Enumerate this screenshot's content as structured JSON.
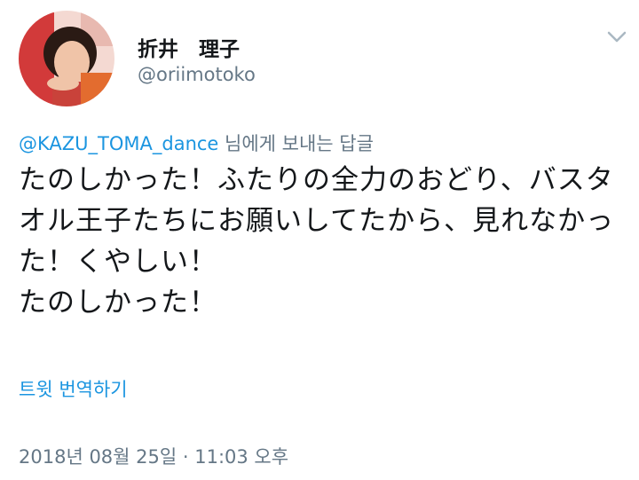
{
  "user": {
    "display_name": "折井　理子",
    "handle": "@oriimotoko"
  },
  "reply": {
    "mention": "@KAZU_TOMA_dance",
    "suffix": " 님에게 보내는 답글"
  },
  "tweet": {
    "text": "たのしかった！ふたりの全力のおどり、バスタオル王子たちにお願いしてたから、見れなかった！くやしい！\nたのしかった！"
  },
  "actions": {
    "translate_label": "트윗 번역하기"
  },
  "meta": {
    "timestamp": "2018년 08월 25일 · 11:03 오후"
  },
  "icons": {
    "menu": "chevron-down-icon"
  },
  "colors": {
    "link": "#1b95e0",
    "secondary": "#657786",
    "text": "#14171a"
  }
}
